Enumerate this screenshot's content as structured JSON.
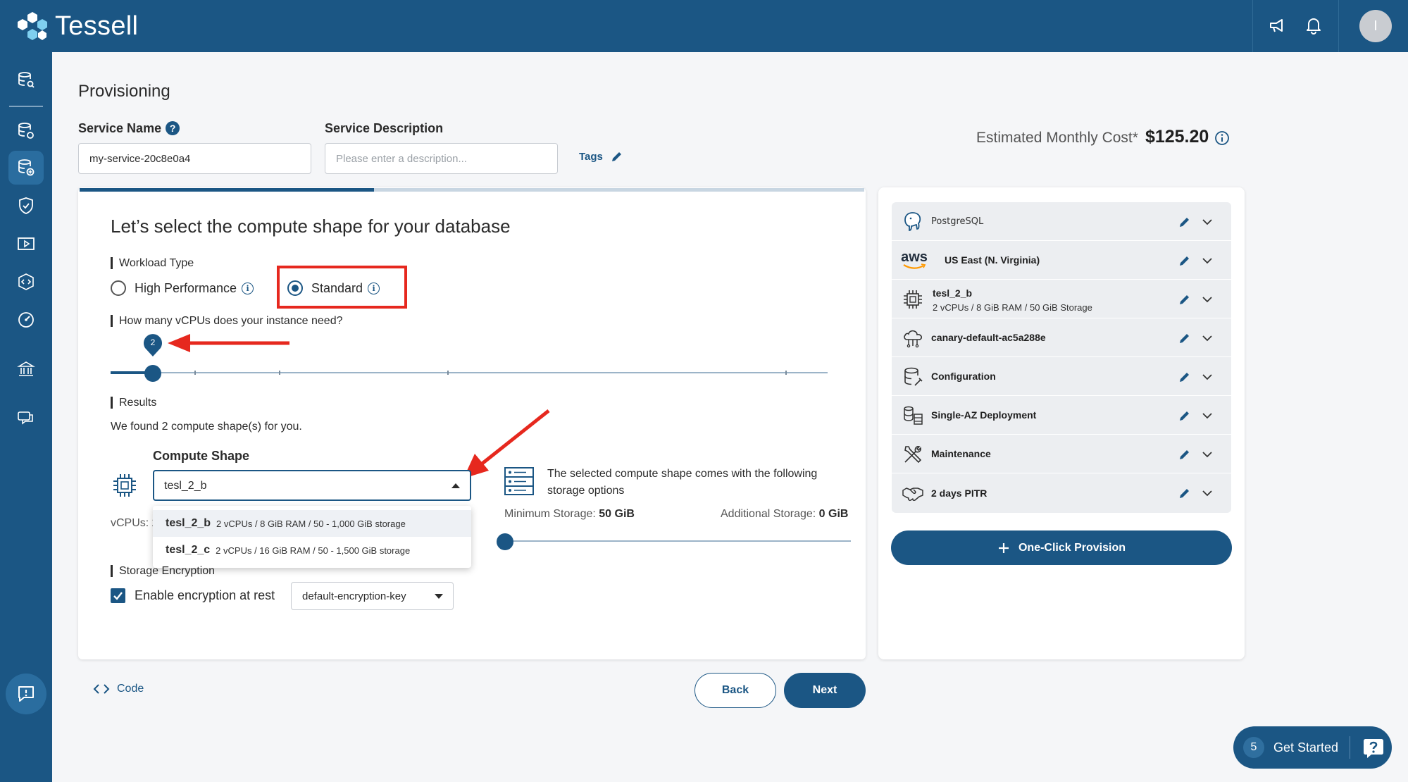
{
  "app": {
    "name": "Tessell"
  },
  "page": {
    "title": "Provisioning"
  },
  "service": {
    "name_label": "Service Name",
    "name_help": "?",
    "name_value": "my-service-20c8e0a4",
    "desc_label": "Service Description",
    "desc_placeholder": "Please enter a description...",
    "tags_label": "Tags"
  },
  "cost": {
    "label": "Estimated Monthly Cost*",
    "value": "$125.20"
  },
  "progress": {
    "fraction": 0.375
  },
  "compute": {
    "title": "Let’s select the compute shape for your database",
    "workload_label": "Workload Type",
    "workload_options": [
      "High Performance",
      "Standard"
    ],
    "workload_selected": "Standard",
    "vcpu_question": "How many vCPUs does your instance need?",
    "vcpu_value": "2",
    "results_label": "Results",
    "results_text": "We found 2 compute shape(s) for you.",
    "shape_label": "Compute Shape",
    "shape_value": "tesl_2_b",
    "vcpus_prefix": "vCPUs: 2",
    "dropdown": [
      {
        "name": "tesl_2_b",
        "desc": "2 vCPUs / 8 GiB RAM / 50 - 1,000 GiB storage"
      },
      {
        "name": "tesl_2_c",
        "desc": "2 vCPUs / 16 GiB RAM / 50 - 1,500 GiB storage"
      }
    ],
    "storage_text": "The selected compute shape comes with the following storage options",
    "min_storage_label": "Minimum Storage:",
    "min_storage_value": "50 GiB",
    "add_storage_label": "Additional Storage:",
    "add_storage_value": "0 GiB",
    "encryption_label": "Storage Encryption",
    "encryption_check_label": "Enable encryption at rest",
    "encryption_key": "default-encryption-key"
  },
  "footer": {
    "code_label": "Code",
    "back_label": "Back",
    "next_label": "Next"
  },
  "summary": {
    "items": [
      {
        "title": "PostgreSQL",
        "sub": "",
        "icon": "postgresql-icon"
      },
      {
        "title": "US East (N. Virginia)",
        "sub": "",
        "icon": "aws-icon",
        "logo_text": "aws"
      },
      {
        "title": "tesl_2_b",
        "sub": "2 vCPUs / 8 GiB RAM / 50 GiB Storage",
        "icon": "chip-icon"
      },
      {
        "title": "canary-default-ac5a288e",
        "sub": "",
        "icon": "cloud-network-icon"
      },
      {
        "title": "Configuration",
        "sub": "",
        "icon": "database-config-icon"
      },
      {
        "title": "Single-AZ Deployment",
        "sub": "",
        "icon": "deployment-icon"
      },
      {
        "title": "Maintenance",
        "sub": "",
        "icon": "tools-icon"
      },
      {
        "title": "2 days PITR",
        "sub": "",
        "icon": "handshake-icon"
      }
    ],
    "one_click_label": "One-Click Provision"
  },
  "get_started": {
    "count": "5",
    "label": "Get Started"
  },
  "user": {
    "initial": "I"
  },
  "colors": {
    "brand": "#1b5684",
    "annotation": "#e6281e"
  }
}
